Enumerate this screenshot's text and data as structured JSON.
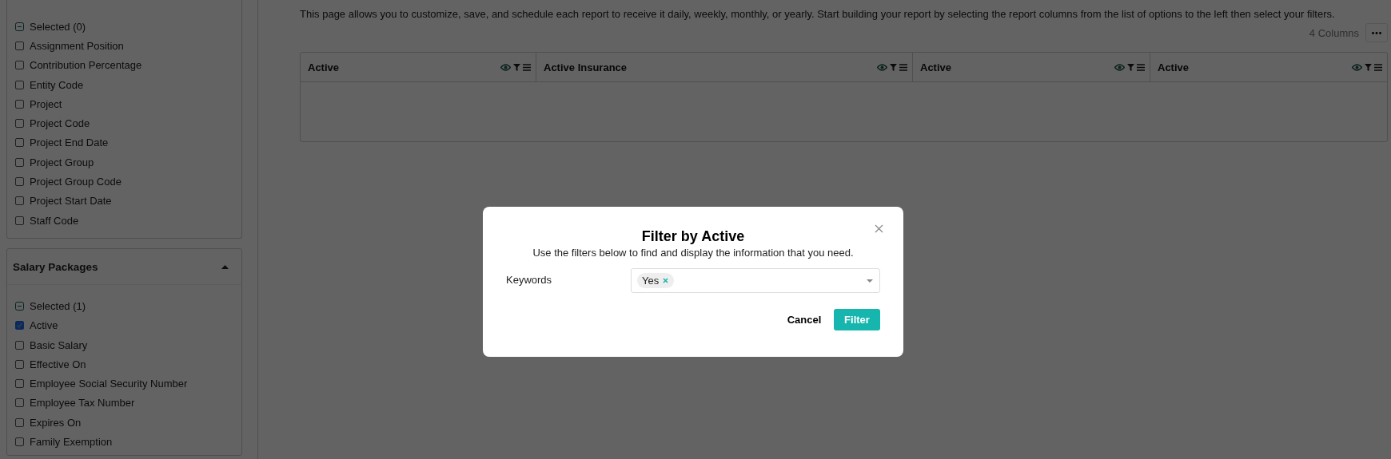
{
  "sidebar": {
    "sections": [
      {
        "selected_summary": "Selected (0)",
        "items": [
          {
            "label": "Assignment Position",
            "checked": false
          },
          {
            "label": "Contribution Percentage",
            "checked": false
          },
          {
            "label": "Entity Code",
            "checked": false
          },
          {
            "label": "Project",
            "checked": false
          },
          {
            "label": "Project Code",
            "checked": false
          },
          {
            "label": "Project End Date",
            "checked": false
          },
          {
            "label": "Project Group",
            "checked": false
          },
          {
            "label": "Project Group Code",
            "checked": false
          },
          {
            "label": "Project Start Date",
            "checked": false
          },
          {
            "label": "Staff Code",
            "checked": false
          }
        ]
      },
      {
        "title": "Salary Packages",
        "expanded": true,
        "selected_summary": "Selected (1)",
        "items": [
          {
            "label": "Active",
            "checked": true
          },
          {
            "label": "Basic Salary",
            "checked": false
          },
          {
            "label": "Effective On",
            "checked": false
          },
          {
            "label": "Employee Social Security Number",
            "checked": false
          },
          {
            "label": "Employee Tax Number",
            "checked": false
          },
          {
            "label": "Expires On",
            "checked": false
          },
          {
            "label": "Family Exemption",
            "checked": false
          }
        ]
      }
    ]
  },
  "main": {
    "description": "This page allows you to customize, save, and schedule each report to receive it daily, weekly, monthly, or yearly. Start building your report by selecting the report columns from the list of options to the left then select your filters.",
    "column_count": "4 Columns",
    "table": {
      "columns": [
        {
          "label": "Active"
        },
        {
          "label": "Active Insurance"
        },
        {
          "label": "Active"
        },
        {
          "label": "Active"
        }
      ]
    }
  },
  "modal": {
    "title": "Filter by Active",
    "subtitle": "Use the filters below to find and display the information that you need.",
    "fields": [
      {
        "label": "Keywords",
        "tags": [
          "Yes"
        ]
      }
    ],
    "buttons": [
      {
        "label": "Cancel",
        "kind": "secondary"
      },
      {
        "label": "Filter",
        "kind": "primary"
      }
    ]
  }
}
